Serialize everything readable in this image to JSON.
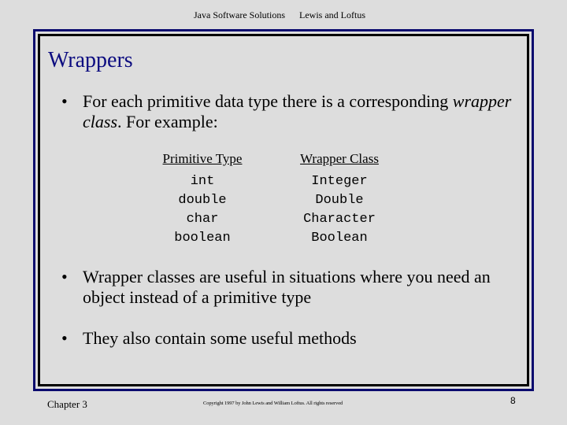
{
  "header": {
    "left": "Java Software Solutions",
    "right": "Lewis and Loftus"
  },
  "slide": {
    "title": "Wrappers",
    "bullets": [
      {
        "text_before": "For each primitive data type there is a corresponding ",
        "text_italic": "wrapper class",
        "text_after": ".  For example:"
      },
      {
        "text": "Wrapper classes are useful in situations where you need an object instead of a primitive type"
      },
      {
        "text": "They also contain some useful methods"
      }
    ],
    "bullet_glyph": "•",
    "table": {
      "headers": [
        "Primitive Type",
        "Wrapper Class"
      ],
      "primitive": [
        "int",
        "double",
        "char",
        "boolean"
      ],
      "wrapper": [
        "Integer",
        "Double",
        "Character",
        "Boolean"
      ]
    }
  },
  "footer": {
    "chapter": "Chapter 3",
    "copyright": "Copyright 1997 by John Lewis and William Loftus.  All rights reserved",
    "page_number": "8"
  },
  "colors": {
    "background": "#dddddd",
    "title": "#0c0c80",
    "outer_frame": "#0a0a6e",
    "inner_frame": "#000000"
  }
}
